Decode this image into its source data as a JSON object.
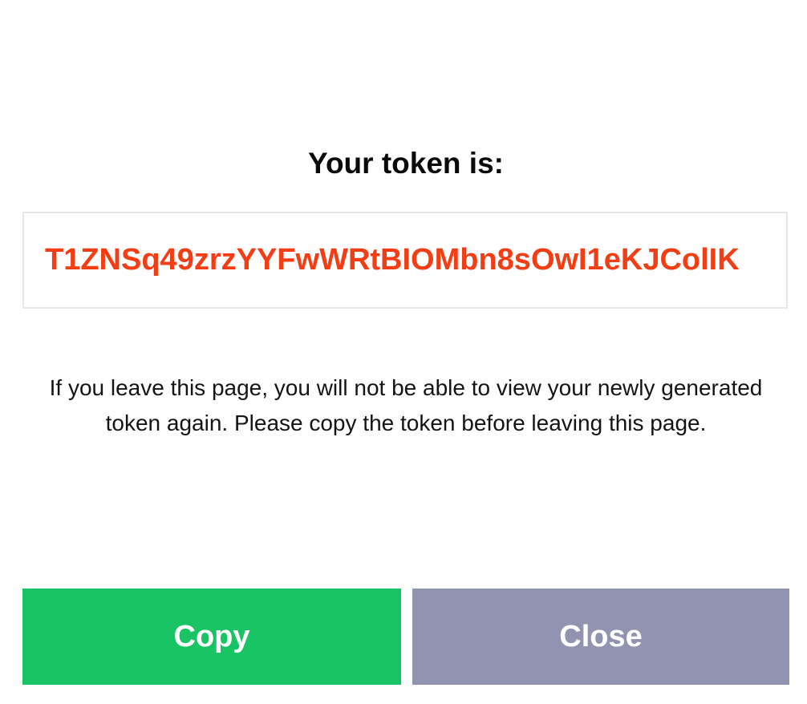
{
  "dialog": {
    "title": "Your token is:",
    "token": "T1ZNSq49zrzYYFwWRtBIOMbn8sOwI1eKJColIK",
    "warning": "If you leave this page, you will not be able to view your newly generated token again. Please copy the token before leaving this page.",
    "copy_label": "Copy",
    "close_label": "Close"
  },
  "colors": {
    "token_text": "#f23d15",
    "copy_button": "#18c463",
    "close_button": "#9194b0"
  }
}
